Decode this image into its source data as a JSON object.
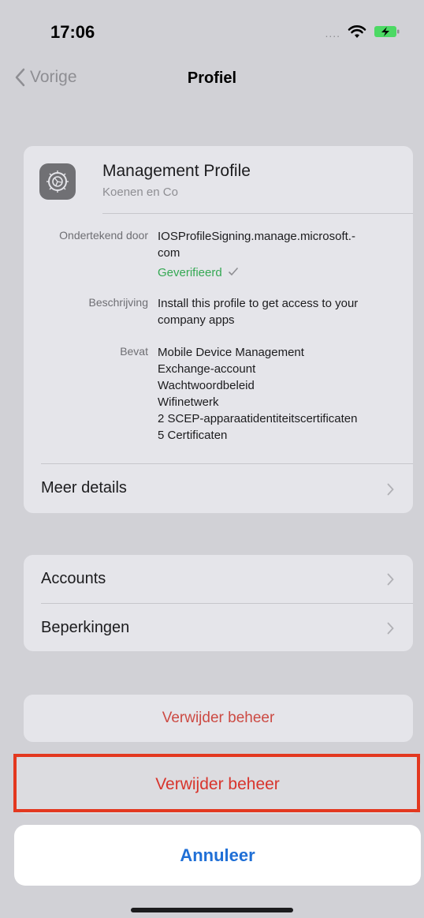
{
  "status_bar": {
    "time": "17:06",
    "signal": "....",
    "icons": [
      "wifi-icon",
      "battery-charging-icon"
    ]
  },
  "nav": {
    "back_label": "Vorige",
    "title": "Profiel"
  },
  "profile": {
    "name": "Management Profile",
    "organization": "Koenen en Co",
    "signed_by_key": "Ondertekend door",
    "signed_by_value_1": "IOSProfileSigning.manage.microsoft.-",
    "signed_by_value_2": "com",
    "verified": "Geverifieerd",
    "description_key": "Beschrijving",
    "description_1": "Install this profile to get access to your",
    "description_2": "company apps",
    "contains_key": "Bevat",
    "contains": [
      "Mobile Device Management",
      "Exchange-account",
      "Wachtwoordbeleid",
      "Wifinetwerk",
      "2 SCEP-apparaatidentiteitscertificaten",
      "5 Certificaten"
    ],
    "more_details": "Meer details"
  },
  "group": {
    "accounts": "Accounts",
    "restrictions": "Beperkingen"
  },
  "remove_management_bg": "Verwijder beheer",
  "action_sheet": {
    "confirm_label": "Verwijder beheer",
    "cancel_label": "Annuleer"
  },
  "colors": {
    "destructive": "#d8342c",
    "link": "#1f6fd6",
    "verified": "#34a853",
    "highlight": "#e3381f"
  }
}
